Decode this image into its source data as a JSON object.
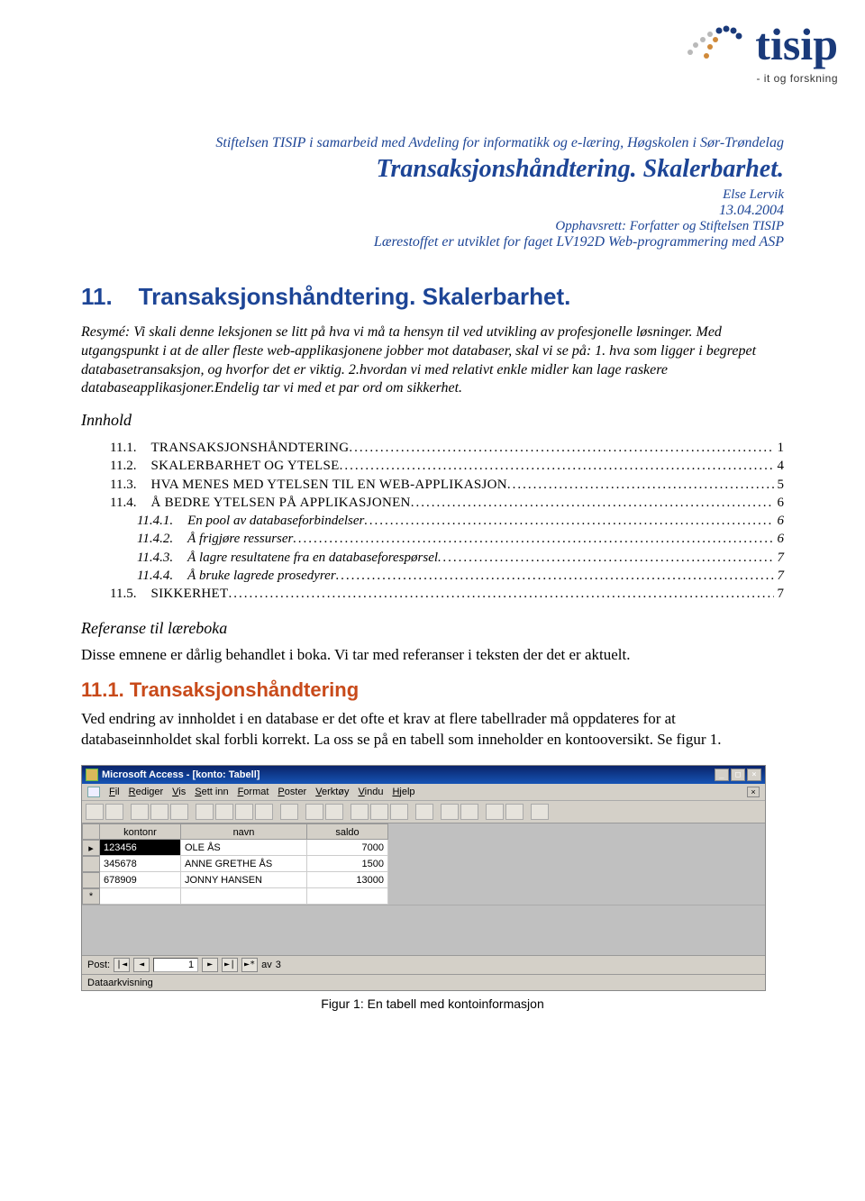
{
  "logo": {
    "brand": "tisip",
    "tagline": "- it og forskning"
  },
  "header": {
    "affiliation": "Stiftelsen TISIP i samarbeid med Avdeling for informatikk og e-læring, Høgskolen i Sør-Trøndelag",
    "title": "Transaksjonshåndtering. Skalerbarhet.",
    "author": "Else Lervik",
    "date": "13.04.2004",
    "copyright": "Opphavsrett: Forfatter og Stiftelsen TISIP",
    "course": "Lærestoffet er utviklet for faget LV192D Web-programmering med ASP"
  },
  "section": {
    "number": "11.",
    "title": "Transaksjonshåndtering. Skalerbarhet."
  },
  "resyme": "Resymé: Vi skali denne leksjonen  se litt på hva vi må ta hensyn til ved utvikling av profesjonelle løsninger. Med utgangspunkt i at de aller fleste web-applikasjonene jobber mot databaser, skal vi se på: 1. hva som ligger i begrepet databasetransaksjon, og hvorfor det er viktig. 2.hvordan vi med relativt enkle midler kan lage raskere databaseapplikasjoner.Endelig tar vi med et par ord om sikkerhet.",
  "innhold_label": "Innhold",
  "toc": [
    {
      "lvl": 1,
      "num": "11.1.",
      "label": "TRANSAKSJONSHÅNDTERING",
      "page": "1",
      "smallcaps": true
    },
    {
      "lvl": 1,
      "num": "11.2.",
      "label": "SKALERBARHET OG YTELSE",
      "page": "4",
      "smallcaps": true
    },
    {
      "lvl": 1,
      "num": "11.3.",
      "label": "HVA MENES MED YTELSEN TIL EN WEB-APPLIKASJON",
      "page": "5",
      "smallcaps": true
    },
    {
      "lvl": 1,
      "num": "11.4.",
      "label": "Å BEDRE YTELSEN PÅ APPLIKASJONEN",
      "page": "6",
      "smallcaps": true
    },
    {
      "lvl": 2,
      "num": "11.4.1.",
      "label": "En pool av databaseforbindelser",
      "page": "6"
    },
    {
      "lvl": 2,
      "num": "11.4.2.",
      "label": "Å frigjøre ressurser",
      "page": "6"
    },
    {
      "lvl": 2,
      "num": "11.4.3.",
      "label": "Å lagre resultatene fra en databaseforespørsel",
      "page": "7"
    },
    {
      "lvl": 2,
      "num": "11.4.4.",
      "label": "Å bruke lagrede prosedyrer",
      "page": "7"
    },
    {
      "lvl": 1,
      "num": "11.5.",
      "label": "SIKKERHET",
      "page": "7",
      "smallcaps": true
    }
  ],
  "ref_title": "Referanse til læreboka",
  "ref_text": "Disse emnene er dårlig behandlet i boka. Vi tar med referanser i teksten der det er aktuelt.",
  "subsection": {
    "number": "11.1.",
    "title": "Transaksjonshåndtering"
  },
  "body_1": "Ved endring av innholdet i en database er det ofte et krav at flere tabellrader må oppdateres for at databaseinnholdet skal forbli korrekt. La oss se på en tabell som inneholder en kontooversikt. Se figur 1.",
  "access": {
    "title": "Microsoft Access - [konto: Tabell]",
    "menu": [
      "Fil",
      "Rediger",
      "Vis",
      "Sett inn",
      "Format",
      "Poster",
      "Verktøy",
      "Vindu",
      "Hjelp"
    ],
    "columns": [
      "kontonr",
      "navn",
      "saldo"
    ],
    "rows": [
      {
        "kontonr": "123456",
        "navn": "OLE ÅS",
        "saldo": "7000"
      },
      {
        "kontonr": "345678",
        "navn": "ANNE GRETHE ÅS",
        "saldo": "1500"
      },
      {
        "kontonr": "678909",
        "navn": "JONNY HANSEN",
        "saldo": "13000"
      }
    ],
    "nav": {
      "label": "Post:",
      "current": "1",
      "of_label": "av",
      "total": "3"
    },
    "status": "Dataarkvisning"
  },
  "figure_caption": "Figur 1: En tabell med kontoinformasjon"
}
